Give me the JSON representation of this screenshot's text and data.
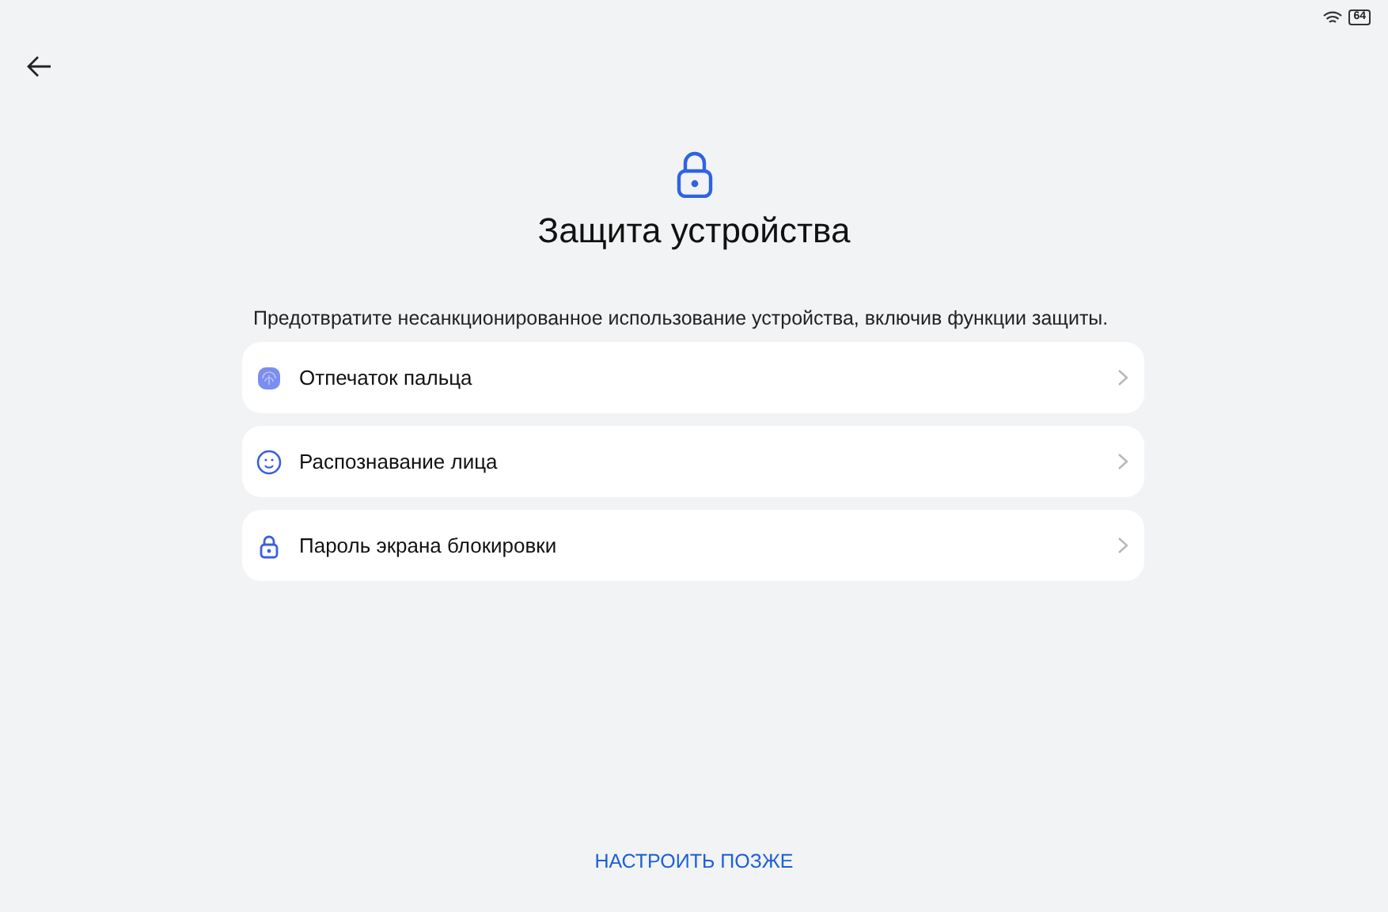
{
  "status_bar": {
    "battery": "64"
  },
  "title": "Защита устройства",
  "description": "Предотвратите несанкционированное использование устройства, включив функции защиты.",
  "items": [
    {
      "kind": "fingerprint",
      "label": "Отпечаток пальца"
    },
    {
      "kind": "face",
      "label": "Распознавание лица"
    },
    {
      "kind": "lock",
      "label": "Пароль экрана блокировки"
    }
  ],
  "later_button": "НАСТРОИТЬ ПОЗЖЕ"
}
